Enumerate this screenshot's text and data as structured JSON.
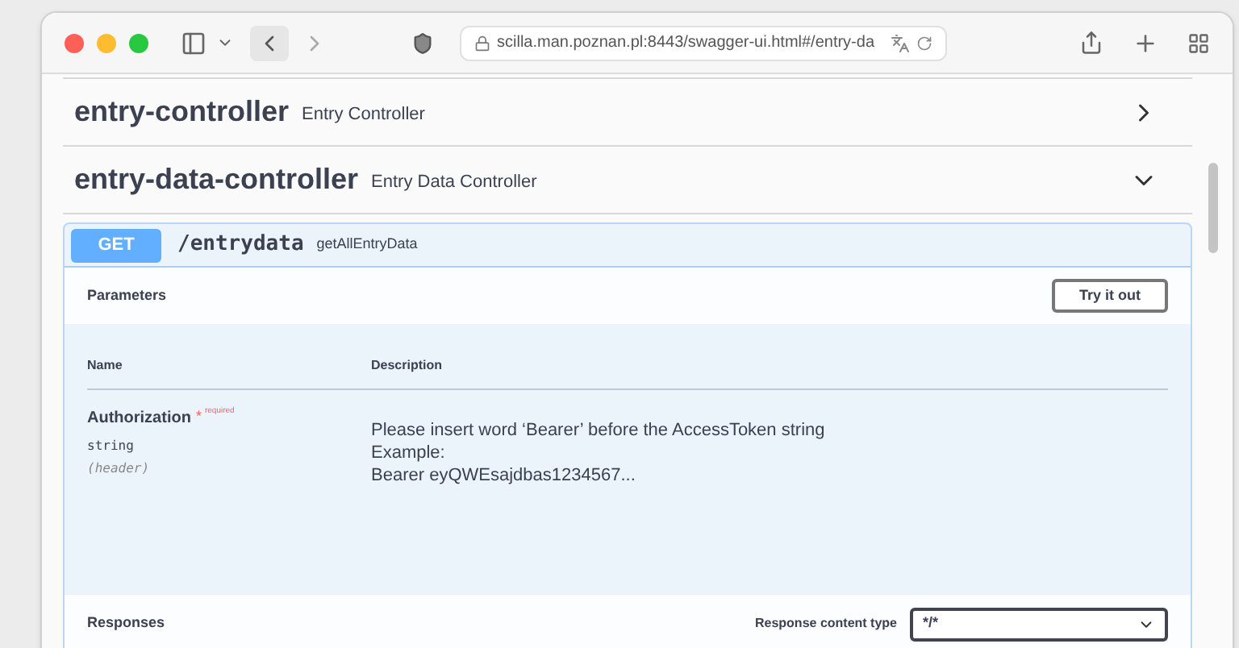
{
  "browser": {
    "url": "scilla.man.poznan.pl:8443/swagger-ui.html#/entry-da"
  },
  "tags": [
    {
      "name": "entry-controller",
      "description": "Entry Controller",
      "expanded": false
    },
    {
      "name": "entry-data-controller",
      "description": "Entry Data Controller",
      "expanded": true
    }
  ],
  "operation": {
    "method": "GET",
    "path": "/entrydata",
    "summary": "getAllEntryData",
    "parameters_title": "Parameters",
    "try_button": "Try it out",
    "columns": [
      "Name",
      "Description"
    ],
    "parameters": [
      {
        "name": "Authorization",
        "required_mark": "*",
        "required_label": "required",
        "type": "string",
        "location": "(header)",
        "description_lines": [
          "Please insert word ‘Bearer’ before the AccessToken string",
          "Example:",
          "Bearer eyQWEsajdbas1234567..."
        ]
      }
    ],
    "responses_title": "Responses",
    "content_type_label": "Response content type",
    "content_type": "*/*"
  }
}
